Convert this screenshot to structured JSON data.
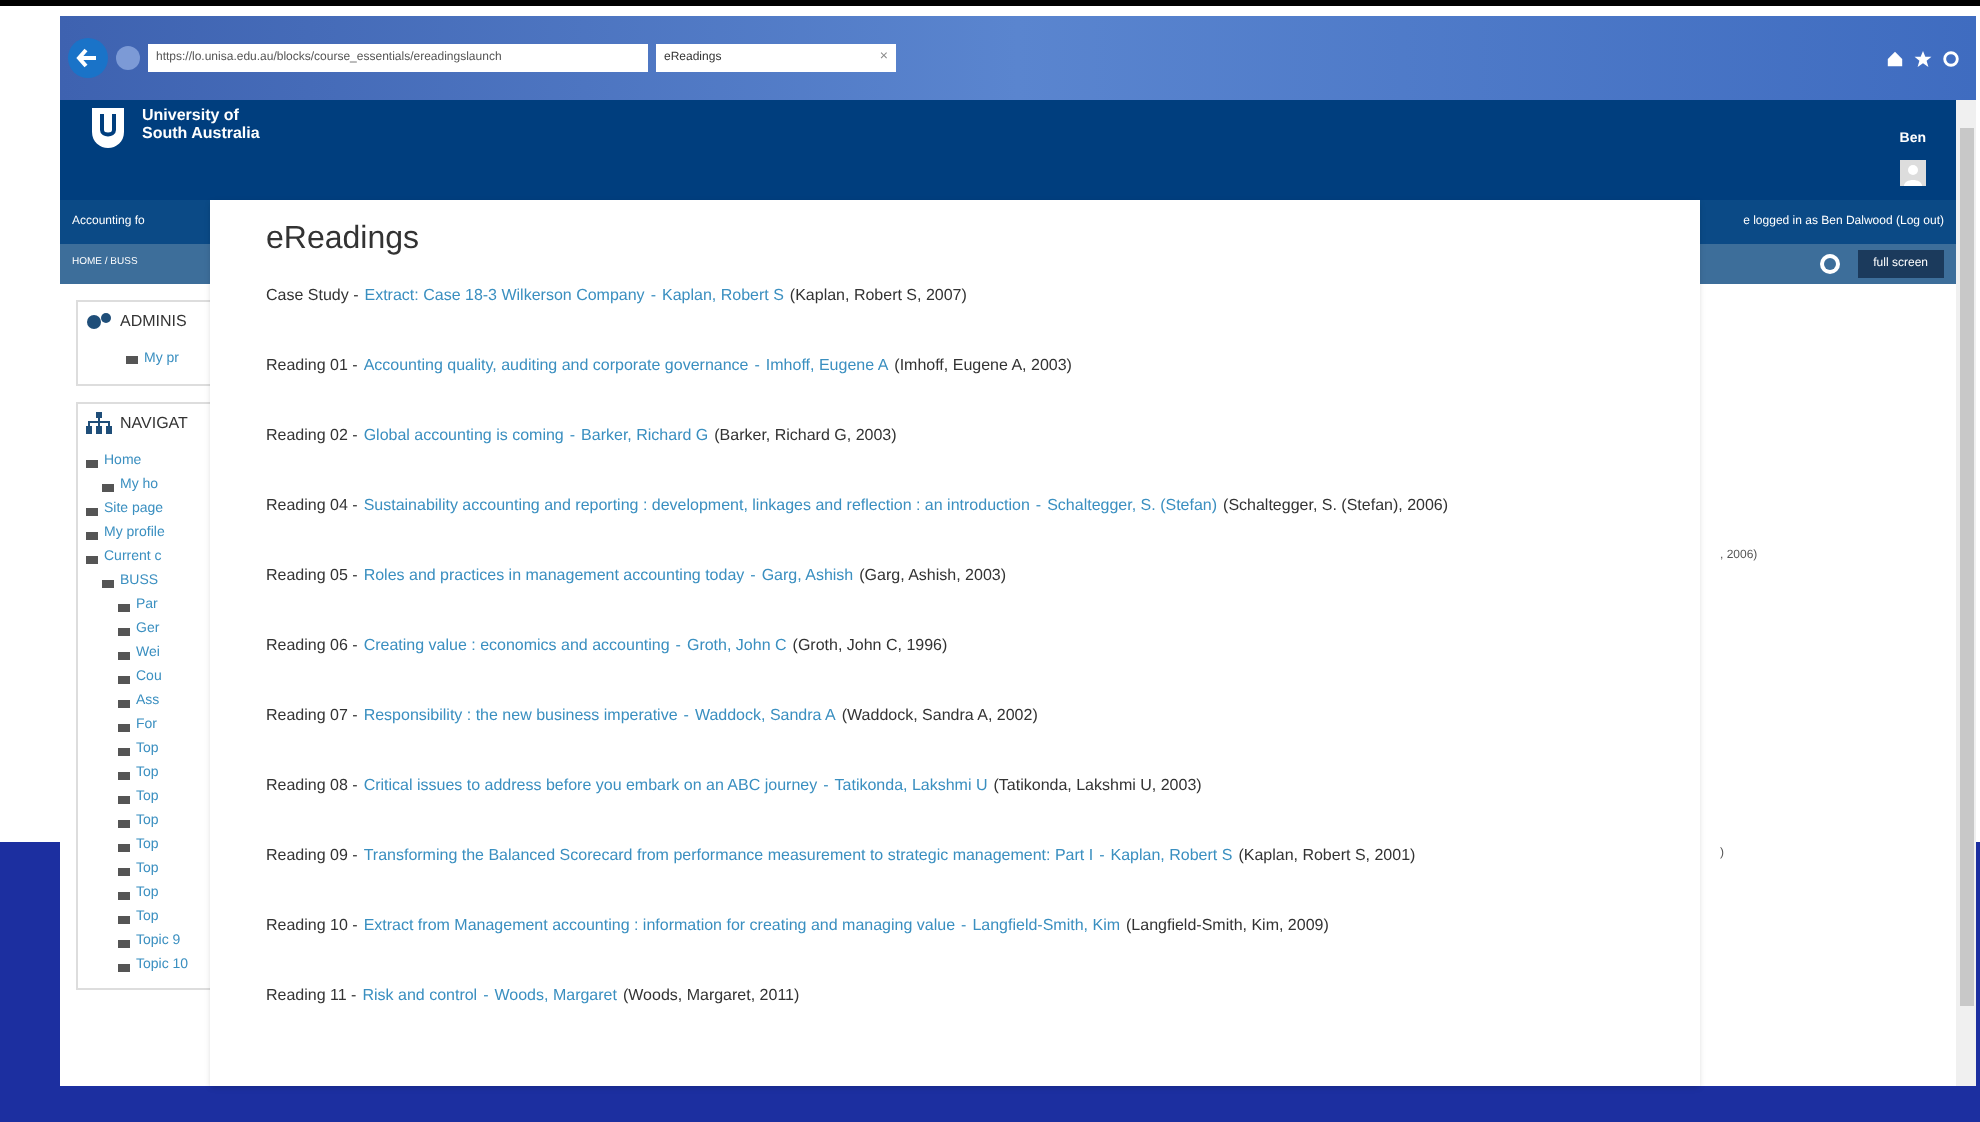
{
  "browser": {
    "address": "https://lo.unisa.edu.au/blocks/course_essentials/ereadingslaunch",
    "tab": {
      "label": "eReadings",
      "close": "×"
    }
  },
  "header": {
    "logo_text": [
      "University of",
      "South Australia"
    ],
    "user": "Ben"
  },
  "nav": {
    "course": "Accounting fo",
    "login_text": "e logged in as Ben Dalwood (Log out)"
  },
  "breadcrumb": {
    "text": "HOME / BUSS",
    "button": "full screen"
  },
  "sidebar": {
    "admin": {
      "title": "ADMINIS",
      "items": [
        "My pr"
      ]
    },
    "navigation": {
      "title": "NAVIGAT",
      "items": [
        {
          "label": "Home",
          "children": [
            {
              "label": "My ho"
            }
          ]
        },
        {
          "label": "Site page"
        },
        {
          "label": "My profile"
        },
        {
          "label": "Current c",
          "children": [
            {
              "label": "BUSS",
              "children": [
                {
                  "label": "Par"
                },
                {
                  "label": "Ger"
                },
                {
                  "label": "Wei"
                },
                {
                  "label": "Cou"
                },
                {
                  "label": "Ass"
                },
                {
                  "label": "For"
                },
                {
                  "label": "Top"
                },
                {
                  "label": "Top"
                },
                {
                  "label": "Top"
                },
                {
                  "label": "Top"
                },
                {
                  "label": "Top"
                },
                {
                  "label": "Top"
                },
                {
                  "label": "Top"
                },
                {
                  "label": "Top"
                },
                {
                  "label": "Topic 9"
                },
                {
                  "label": "Topic 10"
                }
              ]
            }
          ]
        }
      ]
    }
  },
  "background_texts": [
    ", 2006)",
    ")"
  ],
  "modal": {
    "title": "eReadings",
    "readings": [
      {
        "label": "Case Study -",
        "separator": "-",
        "title": "Extract: Case 18-3 Wilkerson Company",
        "author": "Kaplan, Robert S",
        "citation": "(Kaplan, Robert S, 2007)"
      },
      {
        "label": "Reading 01 -",
        "separator": "-",
        "title": "Accounting quality, auditing and corporate governance",
        "author": "Imhoff, Eugene A",
        "citation": "(Imhoff, Eugene A, 2003)"
      },
      {
        "label": "Reading 02 -",
        "separator": "-",
        "title": "Global accounting is coming",
        "author": "Barker, Richard G",
        "citation": "(Barker, Richard G, 2003)"
      },
      {
        "label": "Reading 04 -",
        "separator": "-",
        "title": "Sustainability accounting and reporting : development, linkages and reflection : an introduction",
        "author": "Schaltegger, S. (Stefan)",
        "citation": "(Schaltegger, S. (Stefan), 2006)"
      },
      {
        "label": "Reading 05 -",
        "separator": "-",
        "title": "Roles and practices in management accounting today",
        "author": "Garg, Ashish",
        "citation": "(Garg, Ashish, 2003)"
      },
      {
        "label": "Reading 06 -",
        "separator": "-",
        "title": "Creating value : economics and accounting",
        "author": "Groth, John C",
        "citation": "(Groth, John C, 1996)"
      },
      {
        "label": "Reading 07 -",
        "separator": "-",
        "title": "Responsibility : the new business imperative",
        "author": "Waddock, Sandra A",
        "citation": "(Waddock, Sandra A, 2002)"
      },
      {
        "label": "Reading 08 -",
        "separator": "-",
        "title": "Critical issues to address before you embark on an ABC journey",
        "author": "Tatikonda, Lakshmi U",
        "citation": "(Tatikonda, Lakshmi U, 2003)"
      },
      {
        "label": "Reading 09 -",
        "separator": "-",
        "title": "Transforming the Balanced Scorecard from performance measurement to strategic management: Part I",
        "author": "Kaplan, Robert S",
        "citation": "(Kaplan, Robert S, 2001)"
      },
      {
        "label": "Reading 10 -",
        "separator": "-",
        "title": "Extract from Management accounting : information for creating and managing value",
        "author": "Langfield-Smith, Kim",
        "citation": "(Langfield-Smith, Kim, 2009)"
      },
      {
        "label": "Reading 11 -",
        "separator": "-",
        "title": "Risk and control",
        "author": "Woods, Margaret",
        "citation": "(Woods, Margaret, 2011)"
      }
    ]
  }
}
